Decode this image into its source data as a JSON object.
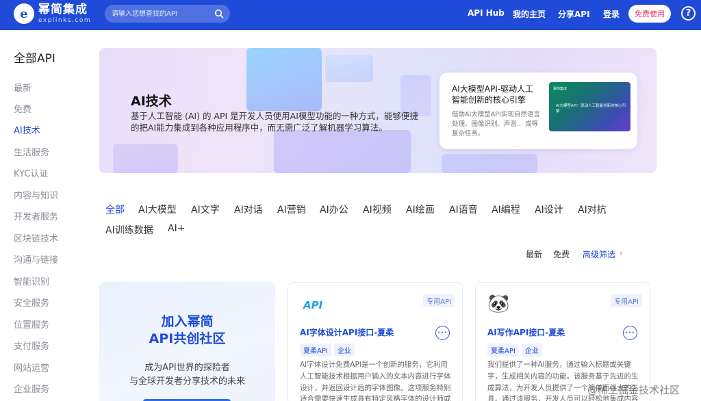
{
  "header": {
    "logo_title": "幂简集成",
    "logo_sub": "explinks.com",
    "search_placeholder": "请输入您想查找的API",
    "nav": [
      "API Hub",
      "我的主页",
      "分享API",
      "登录"
    ],
    "free_button": "免费使用",
    "help": "?"
  },
  "sidebar": {
    "title": "全部API",
    "items": [
      "最新",
      "免费",
      "AI技术",
      "生活服务",
      "KYC认证",
      "内容与知识",
      "开发者服务",
      "区块链技术",
      "沟通与链接",
      "智能识别",
      "安全服务",
      "位置服务",
      "支付服务",
      "网站运营",
      "企业服务"
    ],
    "active": "AI技术"
  },
  "banner": {
    "title": "AI技术",
    "description": "基于人工智能 (AI) 的 API 是开发人员使用AI模型功能的一种方式，能够便捷的把AI能力集成到各种应用程序中，而无需广泛了解机器学习算法。",
    "promo": {
      "title": "AI大模型API-驱动人工智能创新的核心引擎",
      "description": "借助AI大模型API实现自然语言处理、图像识别、声音... 成等复杂任务。",
      "image_logo": "幂简集成",
      "image_text": "AI大模型API：驱动人工智能创新的核心引擎"
    }
  },
  "tabs": {
    "items": [
      "全部",
      "AI大模型",
      "AI文字",
      "AI对话",
      "AI营销",
      "AI办公",
      "AI视频",
      "AI绘画",
      "AI语音",
      "AI编程",
      "AI设计",
      "AI对抗",
      "AI训练数据",
      "AI+"
    ],
    "active": "全部"
  },
  "filters": {
    "latest": "最新",
    "free": "免费",
    "advanced": "高级筛选",
    "advanced_arrow": "›"
  },
  "join_card": {
    "title_line1": "加入幂简",
    "title_line2": "API共创社区",
    "sub_line1": "成为API世界的探险者",
    "sub_line2": "与全球开发者分享技术的未来"
  },
  "api_cards": [
    {
      "tag": "专用API",
      "logo_text": "API",
      "title": "AI字体设计API接口-夏柔",
      "provider": "夏柔API",
      "provider_type": "企业",
      "description": "AI字体设计免费API是一个创新的服务，它利用人工智能技术根据用户输入的文本内容进行字体设计，并返回设计后的字体图像。这项服务特别适合需要快速生成具有特定风格字体的设计师或开发..."
    },
    {
      "tag": "专用API",
      "logo_text": "🐼",
      "title": "AI写作API接口-夏柔",
      "provider": "夏柔API",
      "provider_type": "企业",
      "description": "我们提供了一种AI服务，通过输入标题或关键字，生成相关内容的功能。该服务基于先进的生成算法，为开发人员提供了一个简单而强大的工具。通过该服务，开发人员可以轻松地集成内容生成..."
    }
  ],
  "watermark": "@稀土掘金技术社区",
  "colors": {
    "primary": "#1f4bd8",
    "accent_pink": "#e8336b",
    "muted": "#8a8f99"
  }
}
